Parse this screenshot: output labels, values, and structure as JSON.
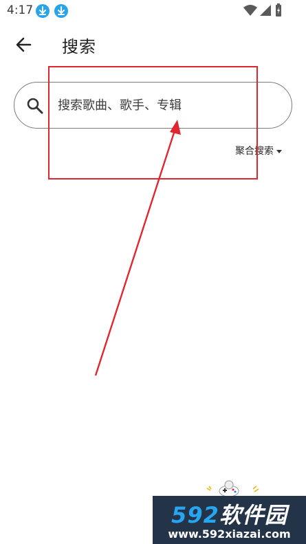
{
  "status_bar": {
    "time": "4:17",
    "icons": [
      "download-icon",
      "download-icon",
      "wifi-icon",
      "cell-signal-icon",
      "battery-charging-icon"
    ]
  },
  "app_bar": {
    "back_icon": "arrow-left-icon",
    "title": "搜索"
  },
  "search": {
    "icon": "search-icon",
    "placeholder": "搜索歌曲、歌手、专辑",
    "value": ""
  },
  "search_mode": {
    "selected": "聚合搜索",
    "icon": "caret-down-icon"
  },
  "annotation": {
    "color": "#e0262f"
  },
  "watermark": {
    "brand_number": "592",
    "brand_text": "软件园",
    "url": "www.592xiazai.com",
    "accent_color": "#27a5f0",
    "background_color": "#233449"
  }
}
